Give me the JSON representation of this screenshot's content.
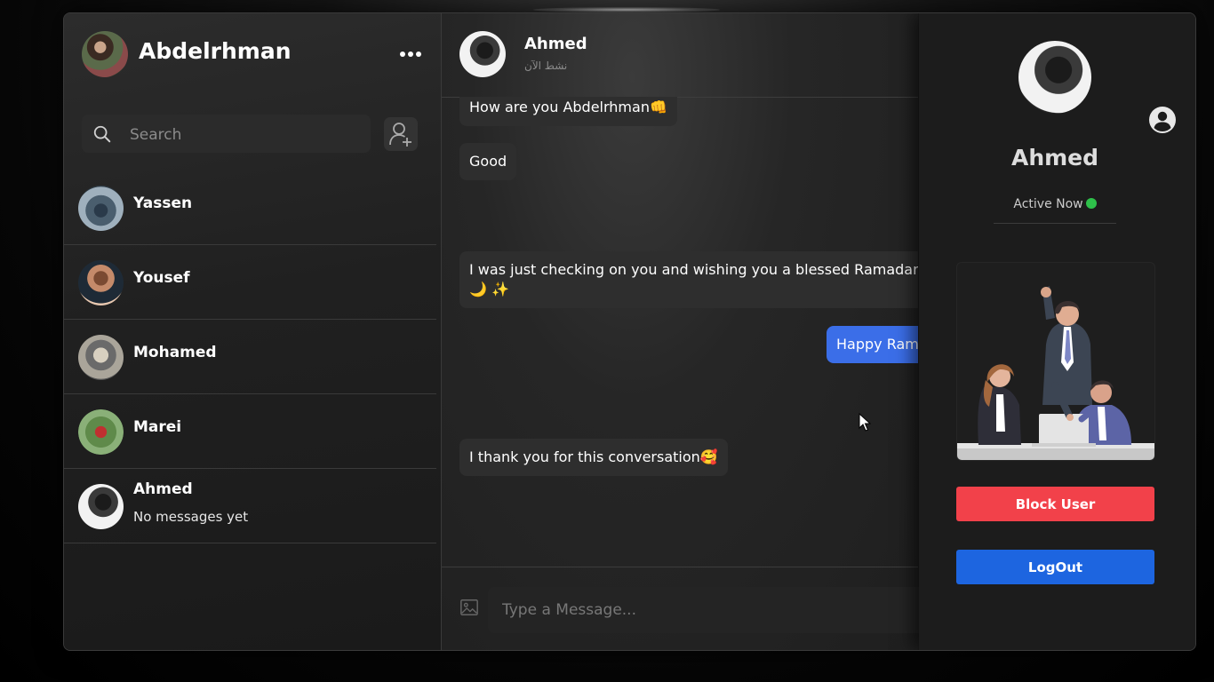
{
  "sidebar": {
    "user_name": "Abdelrhman",
    "search": {
      "placeholder": "Search"
    },
    "contacts": [
      {
        "name": "Yassen",
        "last_message": ""
      },
      {
        "name": "Yousef",
        "last_message": ""
      },
      {
        "name": "Mohamed",
        "last_message": ""
      },
      {
        "name": "Marei",
        "last_message": ""
      },
      {
        "name": "Ahmed",
        "last_message": "No messages yet"
      }
    ]
  },
  "chat": {
    "contact_name": "Ahmed",
    "contact_status": "نشط الآن",
    "messages": [
      {
        "direction": "incoming",
        "text": "How are you Abdelrhman👊"
      },
      {
        "direction": "incoming",
        "text": "Good"
      },
      {
        "direction": "incoming",
        "text": "I was just checking on you and wishing you a blessed Ramadan"
      },
      {
        "direction": "incoming",
        "text": "🌙 ✨"
      },
      {
        "direction": "outgoing",
        "text": "Happy Ram"
      },
      {
        "direction": "incoming",
        "text": "I thank you for this conversation🥰"
      }
    ],
    "input_placeholder": "Type a Message..."
  },
  "profile": {
    "name": "Ahmed",
    "status": "Active Now",
    "status_color": "#2ec04a",
    "block_label": "Block User",
    "block_color": "#f2414a",
    "logout_label": "LogOut",
    "logout_color": "#1d65e0"
  },
  "theme": {
    "outgoing_bubble": "#3b6ee8",
    "incoming_bubble": "#2e2e2e"
  },
  "icons": [
    "more-icon",
    "search-icon",
    "add-user-icon",
    "image-icon",
    "account-icon",
    "mouse-cursor"
  ]
}
